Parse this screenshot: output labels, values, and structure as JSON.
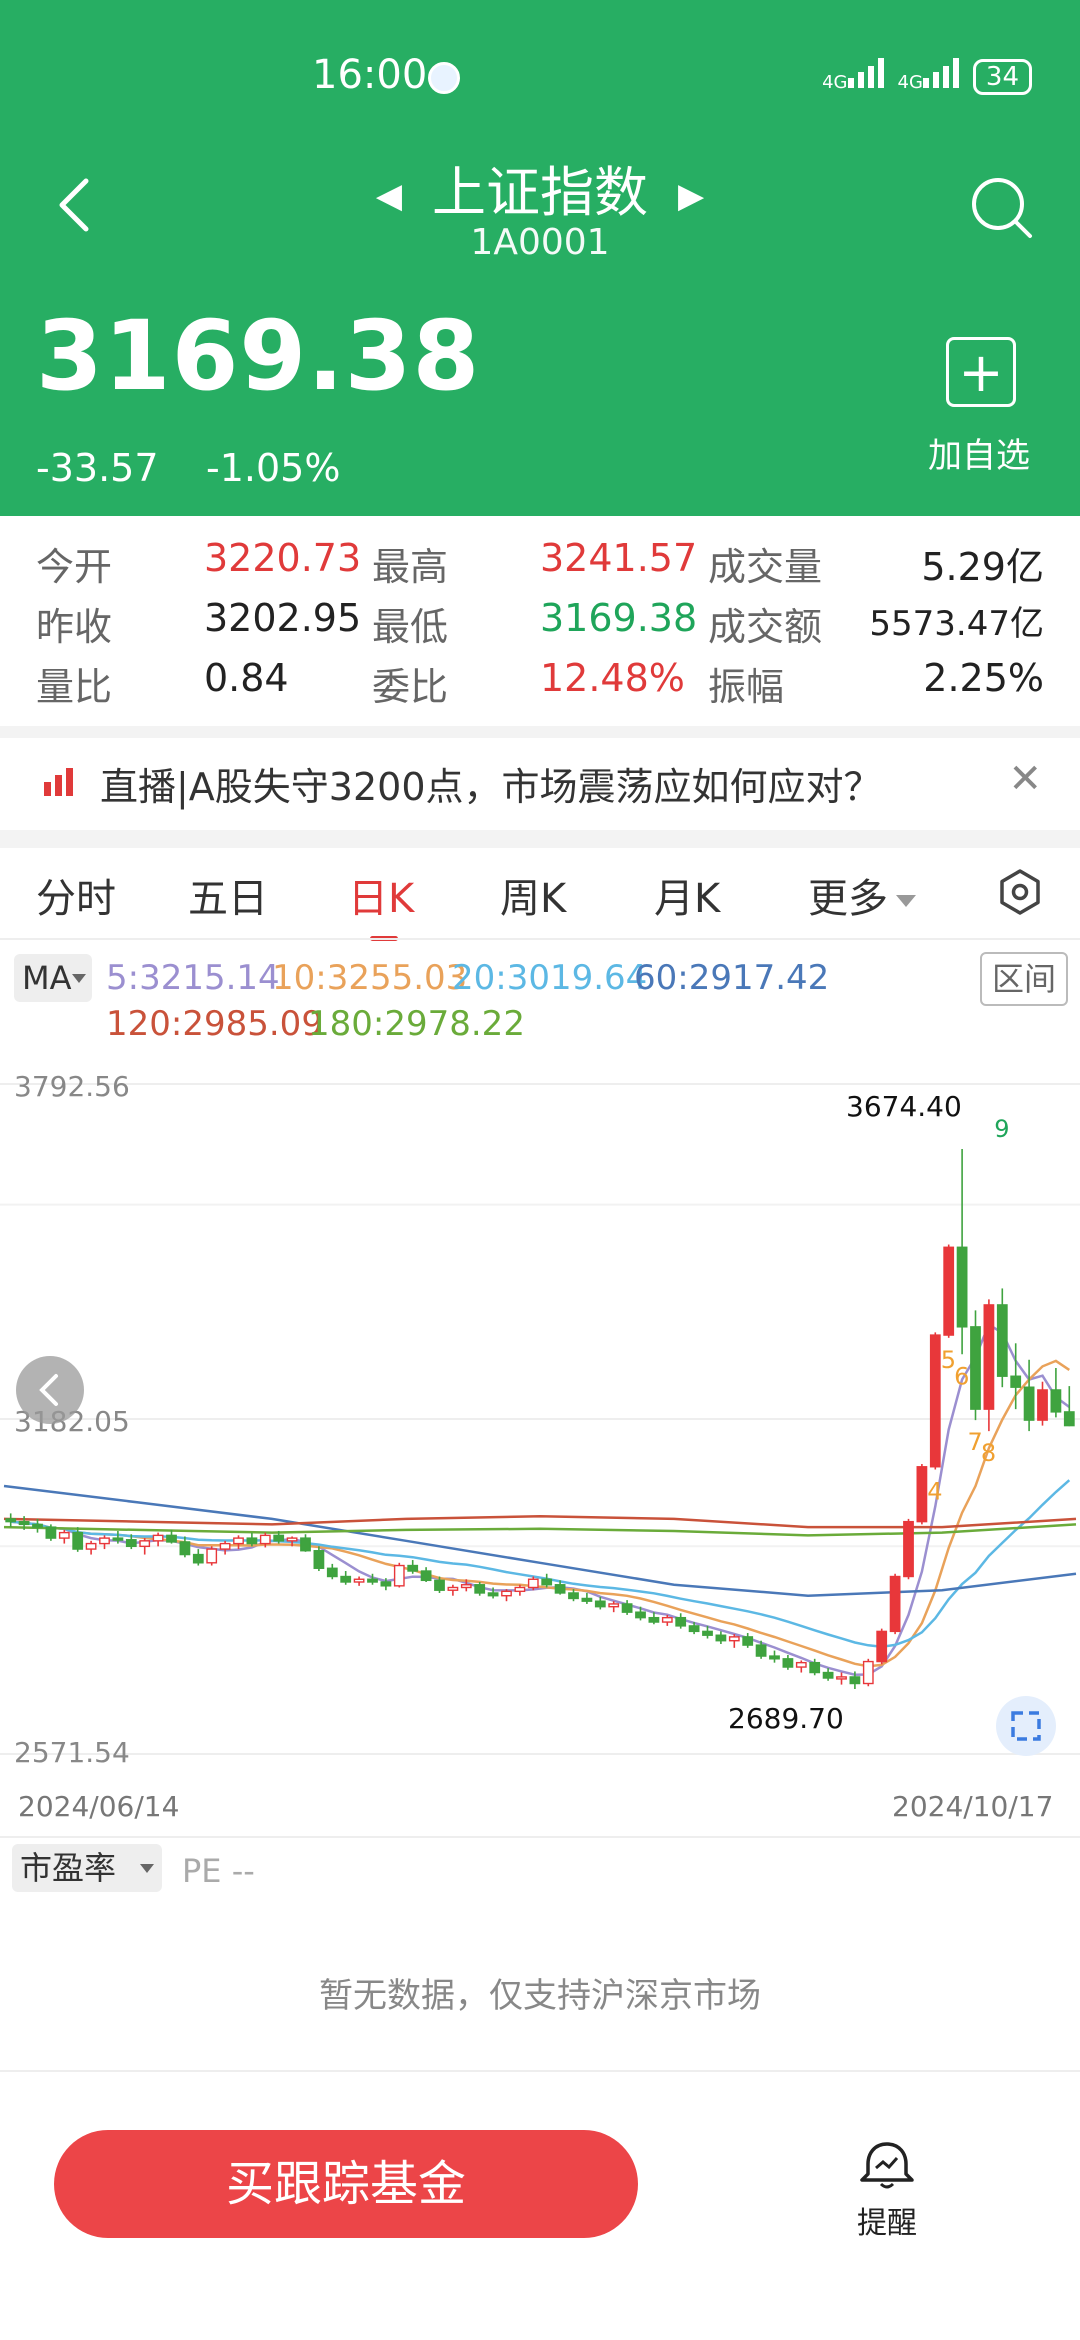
{
  "status": {
    "time": "16:00",
    "net1": "4G",
    "net2": "4G",
    "battery": "34"
  },
  "header": {
    "title": "上证指数",
    "code": "1A0001",
    "price": "3169.38",
    "change": "-33.57",
    "change_pct": "-1.05%",
    "add_label": "加自选"
  },
  "stats": {
    "open_label": "今开",
    "open": "3220.73",
    "high_label": "最高",
    "high": "3241.57",
    "vol_label": "成交量",
    "vol": "5.29亿",
    "prev_label": "昨收",
    "prev": "3202.95",
    "low_label": "最低",
    "low": "3169.38",
    "amt_label": "成交额",
    "amt": "5573.47亿",
    "ratio_label": "量比",
    "ratio": "0.84",
    "commit_label": "委比",
    "commit": "12.48%",
    "amp_label": "振幅",
    "amp": "2.25%"
  },
  "news": {
    "text": "直播|A股失守3200点，市场震荡应如何应对？"
  },
  "tabs": [
    "分时",
    "五日",
    "日K",
    "周K",
    "月K",
    "更多"
  ],
  "active_tab": "日K",
  "ma": {
    "button": "MA",
    "range_button": "区间",
    "items": [
      {
        "text": "5:3215.14",
        "color": "#9b8fd0"
      },
      {
        "text": "10:3255.03",
        "color": "#e9a25a"
      },
      {
        "text": "20:3019.64",
        "color": "#5cb8e4"
      },
      {
        "text": "60:2917.42",
        "color": "#4a78b8"
      },
      {
        "text": "120:2985.09",
        "color": "#c9523a"
      },
      {
        "text": "180:2978.22",
        "color": "#6aab3a"
      }
    ]
  },
  "chart_data": {
    "type": "candlestick",
    "y_top_label": "3792.56",
    "y_mid_label": "3182.05",
    "y_bottom_label": "2571.54",
    "ylim": [
      2571.54,
      3792.56
    ],
    "x_start_label": "2024/06/14",
    "x_end_label": "2024/10/17",
    "high_annotation": "3674.40",
    "low_annotation": "2689.70",
    "up_color": "#e8373a",
    "down_color": "#3fa33f",
    "ohlc": [
      [
        3000,
        3010,
        2985,
        2995
      ],
      [
        2995,
        3005,
        2980,
        2990
      ],
      [
        2990,
        3000,
        2975,
        2985
      ],
      [
        2985,
        2990,
        2960,
        2965
      ],
      [
        2965,
        2980,
        2955,
        2975
      ],
      [
        2975,
        2985,
        2940,
        2945
      ],
      [
        2945,
        2960,
        2935,
        2955
      ],
      [
        2955,
        2970,
        2945,
        2965
      ],
      [
        2965,
        2978,
        2955,
        2962
      ],
      [
        2962,
        2972,
        2945,
        2950
      ],
      [
        2950,
        2965,
        2935,
        2960
      ],
      [
        2960,
        2975,
        2950,
        2970
      ],
      [
        2970,
        2980,
        2955,
        2958
      ],
      [
        2958,
        2968,
        2930,
        2935
      ],
      [
        2935,
        2945,
        2915,
        2920
      ],
      [
        2920,
        2950,
        2915,
        2945
      ],
      [
        2945,
        2960,
        2935,
        2955
      ],
      [
        2955,
        2970,
        2945,
        2965
      ],
      [
        2965,
        2975,
        2950,
        2955
      ],
      [
        2955,
        2975,
        2948,
        2970
      ],
      [
        2970,
        2978,
        2955,
        2960
      ],
      [
        2960,
        2968,
        2950,
        2965
      ],
      [
        2965,
        2972,
        2940,
        2942
      ],
      [
        2942,
        2950,
        2905,
        2910
      ],
      [
        2910,
        2918,
        2890,
        2895
      ],
      [
        2895,
        2905,
        2880,
        2885
      ],
      [
        2885,
        2895,
        2878,
        2890
      ],
      [
        2890,
        2900,
        2880,
        2885
      ],
      [
        2885,
        2892,
        2870,
        2878
      ],
      [
        2878,
        2920,
        2875,
        2915
      ],
      [
        2915,
        2925,
        2900,
        2905
      ],
      [
        2905,
        2912,
        2885,
        2888
      ],
      [
        2888,
        2895,
        2865,
        2870
      ],
      [
        2870,
        2880,
        2860,
        2875
      ],
      [
        2875,
        2890,
        2868,
        2880
      ],
      [
        2880,
        2885,
        2860,
        2865
      ],
      [
        2865,
        2875,
        2855,
        2860
      ],
      [
        2860,
        2872,
        2850,
        2868
      ],
      [
        2868,
        2880,
        2860,
        2875
      ],
      [
        2875,
        2895,
        2870,
        2890
      ],
      [
        2890,
        2900,
        2875,
        2880
      ],
      [
        2880,
        2888,
        2862,
        2865
      ],
      [
        2865,
        2872,
        2850,
        2855
      ],
      [
        2855,
        2865,
        2845,
        2850
      ],
      [
        2850,
        2858,
        2835,
        2840
      ],
      [
        2840,
        2850,
        2830,
        2845
      ],
      [
        2845,
        2852,
        2825,
        2830
      ],
      [
        2830,
        2840,
        2815,
        2820
      ],
      [
        2820,
        2830,
        2808,
        2812
      ],
      [
        2812,
        2825,
        2805,
        2820
      ],
      [
        2820,
        2828,
        2800,
        2805
      ],
      [
        2805,
        2812,
        2790,
        2795
      ],
      [
        2795,
        2805,
        2782,
        2788
      ],
      [
        2788,
        2795,
        2772,
        2778
      ],
      [
        2778,
        2790,
        2765,
        2785
      ],
      [
        2785,
        2792,
        2765,
        2770
      ],
      [
        2770,
        2778,
        2745,
        2750
      ],
      [
        2750,
        2760,
        2738,
        2745
      ],
      [
        2745,
        2752,
        2725,
        2730
      ],
      [
        2730,
        2742,
        2720,
        2738
      ],
      [
        2738,
        2745,
        2715,
        2720
      ],
      [
        2720,
        2728,
        2705,
        2710
      ],
      [
        2710,
        2720,
        2698,
        2712
      ],
      [
        2712,
        2722,
        2690,
        2700
      ],
      [
        2700,
        2745,
        2695,
        2740
      ],
      [
        2740,
        2800,
        2735,
        2795
      ],
      [
        2795,
        2900,
        2790,
        2895
      ],
      [
        2895,
        3000,
        2890,
        2995
      ],
      [
        2995,
        3100,
        2990,
        3095
      ],
      [
        3095,
        3340,
        3090,
        3335
      ],
      [
        3335,
        3500,
        3330,
        3495
      ],
      [
        3495,
        3674,
        3300,
        3350
      ],
      [
        3350,
        3380,
        3180,
        3200
      ],
      [
        3200,
        3400,
        3160,
        3390
      ],
      [
        3390,
        3420,
        3240,
        3260
      ],
      [
        3260,
        3320,
        3200,
        3240
      ],
      [
        3240,
        3290,
        3160,
        3180
      ],
      [
        3180,
        3250,
        3170,
        3235
      ],
      [
        3235,
        3275,
        3185,
        3195
      ],
      [
        3195,
        3242,
        3169,
        3170
      ]
    ]
  },
  "pe": {
    "button": "市盈率",
    "label": "PE --",
    "empty_text": "暂无数据，仅支持沪深京市场"
  },
  "bottom": {
    "buy_label": "买跟踪基金",
    "remind_label": "提醒"
  },
  "colors": {
    "header_green": "#27ae63",
    "red": "#e03a3a",
    "green": "#1fa55a"
  }
}
